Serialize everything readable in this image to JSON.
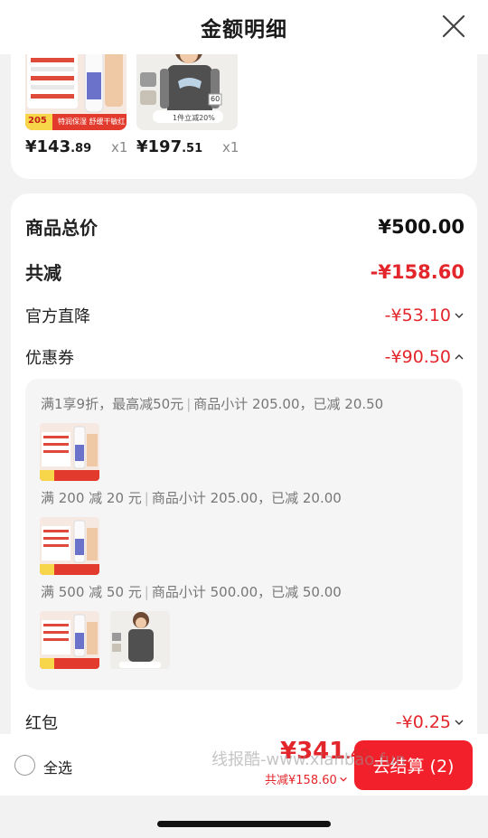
{
  "header": {
    "title": "金额明细"
  },
  "products": [
    {
      "price_main": "¥143",
      "price_decimal": ".89",
      "qty": "x1",
      "promo_badge": "205",
      "promo_text": "特润保湿 舒缓干敏红"
    },
    {
      "price_main": "¥197",
      "price_decimal": ".51",
      "qty": "x1",
      "size_tag": "60",
      "promo_text": "1件立减20%"
    }
  ],
  "summary": {
    "total_label": "商品总价",
    "total_value": "¥500.00",
    "reduce_label": "共减",
    "reduce_value": "-¥158.60",
    "official_label": "官方直降",
    "official_value": "-¥53.10",
    "coupon_label": "优惠券",
    "coupon_value": "-¥90.50",
    "redpacket_label": "红包",
    "redpacket_value": "-¥0.25"
  },
  "coupons": [
    {
      "rule": "满1享9折，最高减50元",
      "detail": "商品小计 205.00，已减 20.50"
    },
    {
      "rule": "满 200 减 20 元",
      "detail": "商品小计 205.00，已减 20.00"
    },
    {
      "rule": "满 500 减 50 元",
      "detail": "商品小计 500.00，已减 50.00"
    }
  ],
  "bottom": {
    "select_all": "全选",
    "watermark": "线报酷-www.xianbao.fun",
    "total_main": "¥341",
    "total_decimal": ".40",
    "saved": "共减¥158.60",
    "checkout": "去结算 (2)"
  },
  "colors": {
    "accent": "#e3262b",
    "button": "#f2202a"
  }
}
